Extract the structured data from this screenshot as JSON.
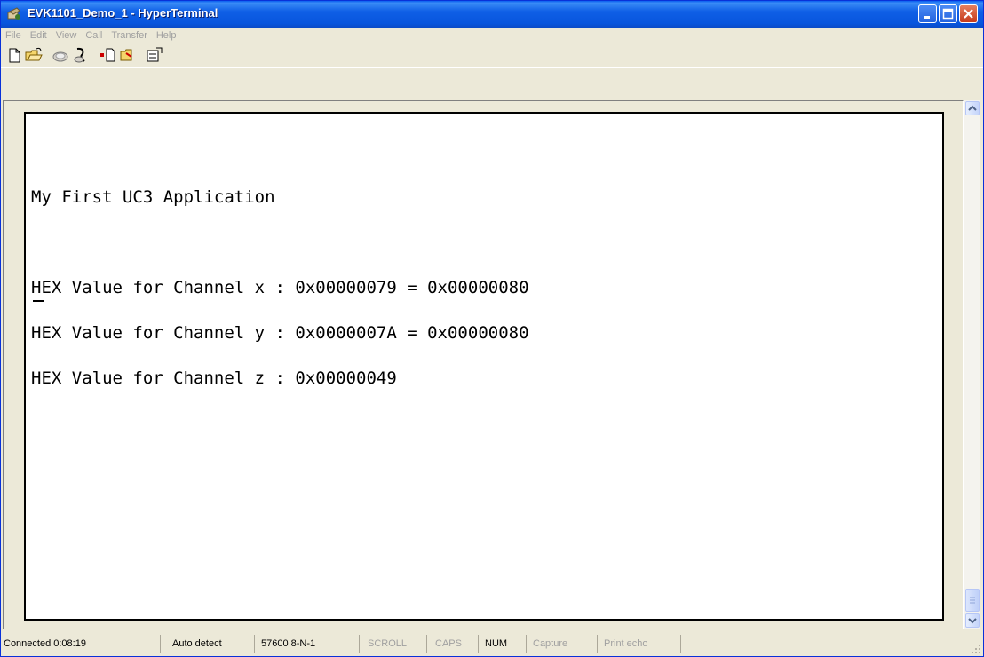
{
  "window": {
    "title": "EVK1101_Demo_1 - HyperTerminal"
  },
  "menu": [
    "File",
    "Edit",
    "View",
    "Call",
    "Transfer",
    "Help"
  ],
  "toolbar": {
    "icons": [
      "new-icon",
      "open-icon",
      "call-icon",
      "disconnect-icon",
      "send-icon",
      "receive-icon",
      "properties-icon"
    ]
  },
  "terminal": {
    "lines": [
      "My First UC3 Application",
      "",
      "HEX Value for Channel x : 0x00000079 = 0x00000080",
      "HEX Value for Channel y : 0x0000007A = 0x00000080",
      "HEX Value for Channel z : 0x00000049"
    ],
    "cursor": "_"
  },
  "status": {
    "connected": "Connected 0:08:19",
    "detect": "Auto detect",
    "settings": "57600 8-N-1",
    "scroll": "SCROLL",
    "caps": "CAPS",
    "num": "NUM",
    "capture": "Capture",
    "print_echo": "Print echo"
  },
  "colors": {
    "titlebar": "#0855DD",
    "face": "#ECE9D8",
    "terminal_bg": "#FFFFFF",
    "terminal_text": "#000000"
  }
}
